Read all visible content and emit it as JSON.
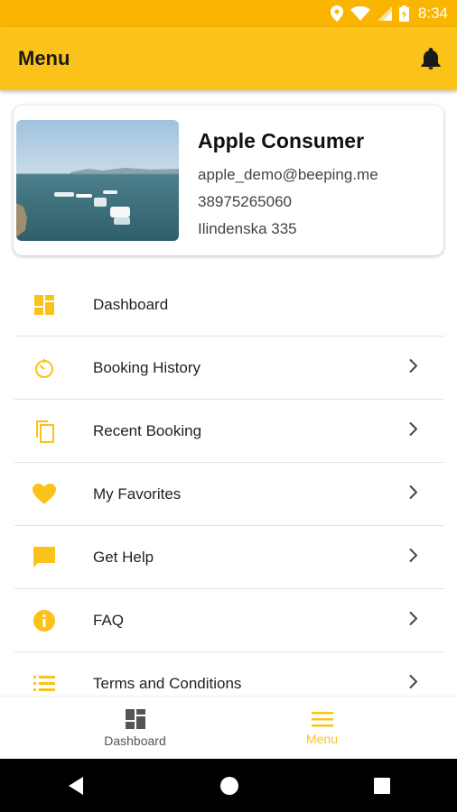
{
  "status_bar": {
    "time": "8:34"
  },
  "app_bar": {
    "title": "Menu"
  },
  "profile": {
    "name": "Apple Consumer",
    "email": "apple_demo@beeping.me",
    "phone": "38975265060",
    "address": "Ilindenska 335"
  },
  "menu": {
    "items": [
      {
        "label": "Dashboard",
        "icon": "dashboard-icon"
      },
      {
        "label": "Booking History",
        "icon": "timer-icon"
      },
      {
        "label": "Recent Booking",
        "icon": "copy-icon"
      },
      {
        "label": "My Favorites",
        "icon": "heart-icon"
      },
      {
        "label": "Get Help",
        "icon": "chat-icon"
      },
      {
        "label": "FAQ",
        "icon": "info-icon"
      },
      {
        "label": "Terms and Conditions",
        "icon": "list-icon"
      }
    ]
  },
  "bottom_nav": {
    "dashboard_label": "Dashboard",
    "menu_label": "Menu"
  },
  "colors": {
    "accent": "#FBC21A",
    "status_bar": "#F9B500",
    "icon_yellow": "#FBC21A",
    "inactive_nav": "#555555"
  }
}
